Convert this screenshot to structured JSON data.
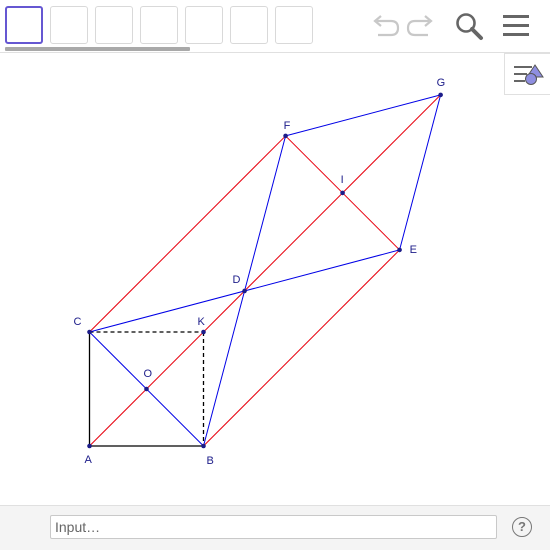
{
  "toolbar": {
    "tools": [
      {
        "name": "tool-move",
        "selected": true
      },
      {
        "name": "tool-point",
        "selected": false
      },
      {
        "name": "tool-line",
        "selected": false
      },
      {
        "name": "tool-perpendicular",
        "selected": false
      },
      {
        "name": "tool-polygon",
        "selected": false
      },
      {
        "name": "tool-circle",
        "selected": false
      },
      {
        "name": "tool-angle",
        "selected": false
      }
    ],
    "actions": [
      "undo-icon",
      "redo-icon",
      "search-icon",
      "hamburger-menu-icon"
    ]
  },
  "algebra_toggle_icon": "algebra-view-icon",
  "construction": {
    "points": [
      {
        "id": "A",
        "label": "A",
        "x": 0,
        "y": 0
      },
      {
        "id": "B",
        "label": "B",
        "x": 2,
        "y": 0
      },
      {
        "id": "C",
        "label": "C",
        "x": 0,
        "y": 2
      },
      {
        "id": "K",
        "label": "K",
        "x": 2,
        "y": 2
      },
      {
        "id": "O",
        "label": "O",
        "x": 1,
        "y": 1
      },
      {
        "id": "D",
        "label": "D",
        "x": 2.72,
        "y": 2.72
      },
      {
        "id": "E",
        "label": "E",
        "x": 5.44,
        "y": 3.44
      },
      {
        "id": "F",
        "label": "F",
        "x": 3.44,
        "y": 5.44
      },
      {
        "id": "G",
        "label": "G",
        "x": 6.16,
        "y": 6.16
      },
      {
        "id": "I",
        "label": "I",
        "x": 4.44,
        "y": 4.44
      }
    ],
    "segments": [
      {
        "from": "A",
        "to": "B",
        "color": "#000000",
        "dashed": false
      },
      {
        "from": "A",
        "to": "C",
        "color": "#000000",
        "dashed": false
      },
      {
        "from": "C",
        "to": "K",
        "color": "#000000",
        "dashed": true
      },
      {
        "from": "K",
        "to": "B",
        "color": "#000000",
        "dashed": true
      },
      {
        "from": "A",
        "to": "G",
        "color": "#e8000e",
        "dashed": false
      },
      {
        "from": "C",
        "to": "F",
        "color": "#e8000e",
        "dashed": false
      },
      {
        "from": "B",
        "to": "E",
        "color": "#e8000e",
        "dashed": false
      },
      {
        "from": "F",
        "to": "E",
        "color": "#e8000e",
        "dashed": false
      },
      {
        "from": "C",
        "to": "B",
        "color": "#0000e6",
        "dashed": false
      },
      {
        "from": "C",
        "to": "E",
        "color": "#0000e6",
        "dashed": false
      },
      {
        "from": "B",
        "to": "F",
        "color": "#0000e6",
        "dashed": false
      },
      {
        "from": "F",
        "to": "G",
        "color": "#0000e6",
        "dashed": false
      },
      {
        "from": "G",
        "to": "E",
        "color": "#0000e6",
        "dashed": false
      }
    ]
  },
  "input": {
    "placeholder": "Input…",
    "value": ""
  },
  "help": {
    "label": "?"
  },
  "colors": {
    "point": "#1c1c89",
    "selected_tool": "#6557d2",
    "red": "#e8000e",
    "blue": "#0000e6"
  }
}
